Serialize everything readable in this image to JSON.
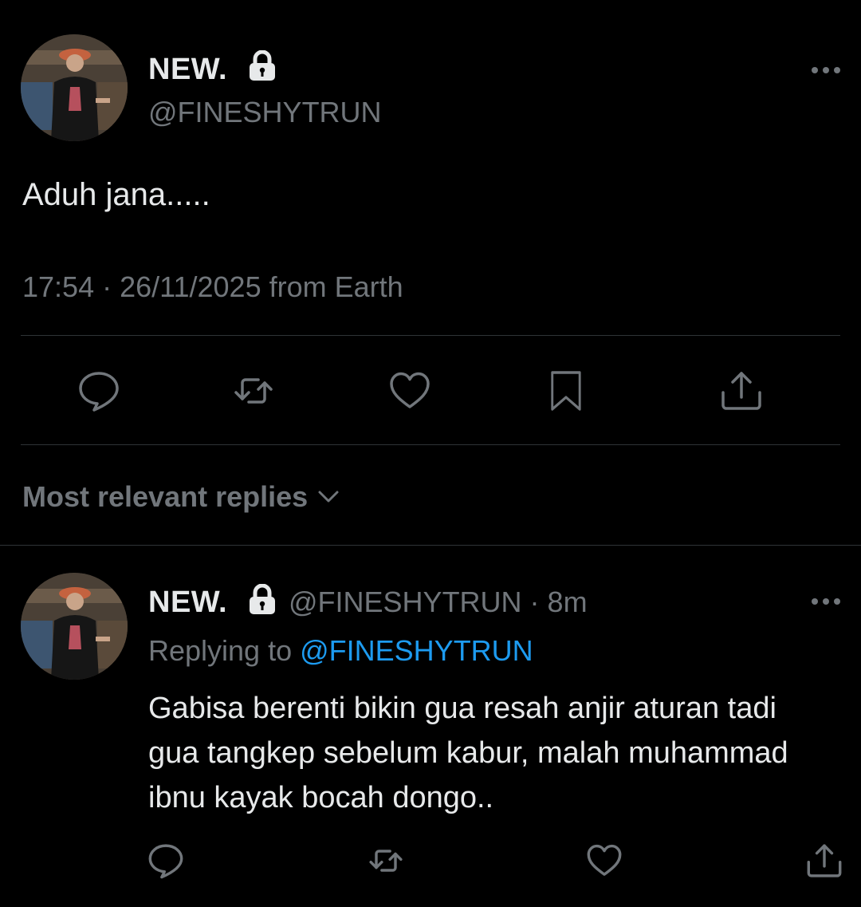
{
  "main_tweet": {
    "display_name": "NEW.",
    "handle": "@FINESHYTRUN",
    "text": "Aduh jana.....",
    "timestamp": "17:54 · 26/11/2025 from Earth",
    "icons": {
      "lock": "lock-icon",
      "more": "more-horizontal-icon",
      "reply": "reply-icon",
      "retweet": "retweet-icon",
      "like": "heart-icon",
      "bookmark": "bookmark-icon",
      "share": "share-icon"
    }
  },
  "sort": {
    "label": "Most relevant replies",
    "icon": "chevron-down-icon"
  },
  "reply": {
    "display_name": "NEW.",
    "meta": "@FINESHYTRUN · 8m",
    "replying_prefix": "Replying to",
    "replying_mention": "@FINESHYTRUN",
    "text": "Gabisa berenti bikin gua resah anjir aturan tadi gua tangkep sebelum kabur, malah muhammad ibnu kayak bocah dongo.."
  },
  "colors": {
    "background": "#000000",
    "text_primary": "#e7e9ea",
    "text_secondary": "#71767b",
    "accent": "#1d9bf0",
    "divider": "#2f3336"
  }
}
